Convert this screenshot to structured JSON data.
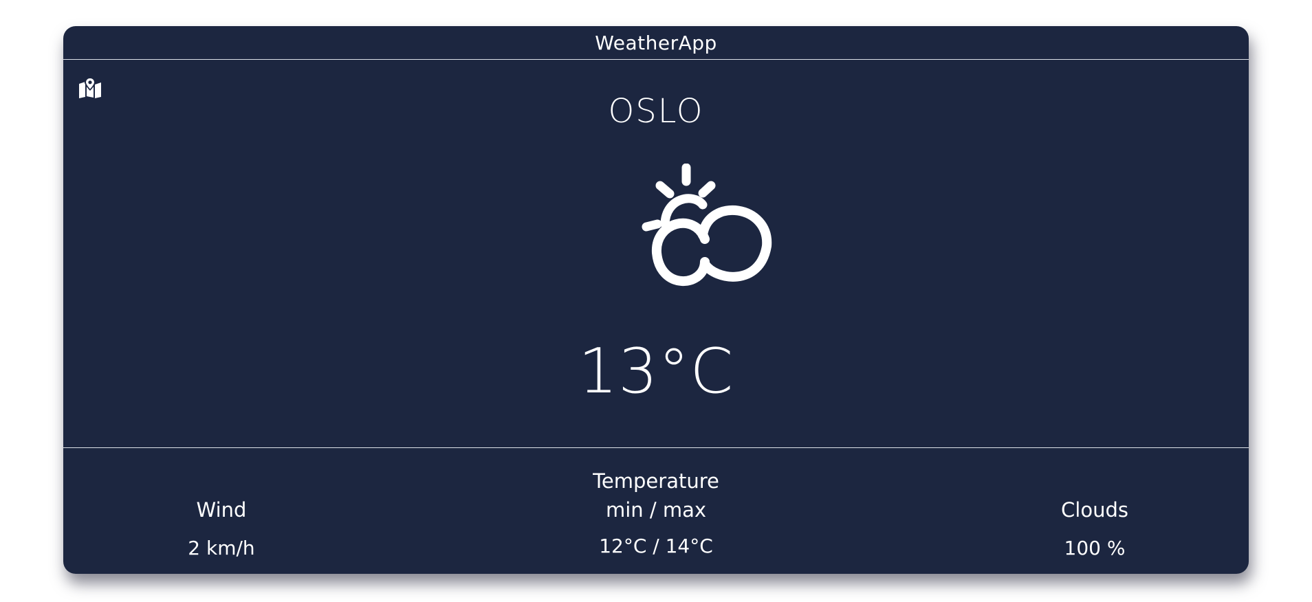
{
  "app": {
    "title": "WeatherApp"
  },
  "header": {
    "map_icon": "map-location-icon"
  },
  "current": {
    "city": "OSLO",
    "condition_icon": "partly-cloudy-icon",
    "temperature": "13°C"
  },
  "stats": {
    "wind": {
      "label": "Wind",
      "value": "2 km/h"
    },
    "temperature": {
      "label_line1": "Temperature",
      "label_line2": "min / max",
      "value": "12°C / 14°C"
    },
    "clouds": {
      "label": "Clouds",
      "value": "100 %"
    }
  },
  "colors": {
    "card_background": "#1c2640",
    "text": "#ffffff",
    "divider": "#dfe3ea"
  }
}
